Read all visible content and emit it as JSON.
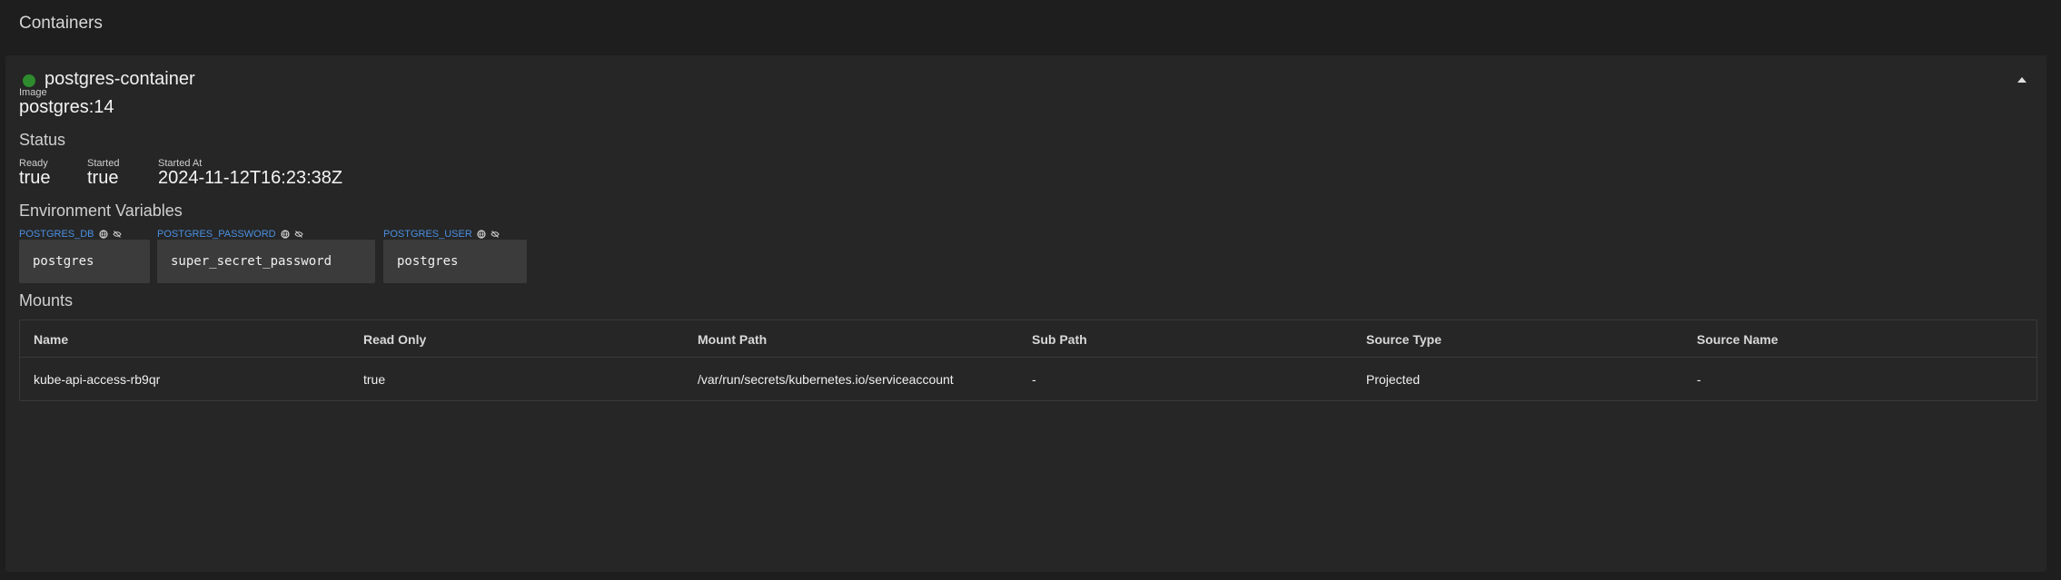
{
  "page": {
    "title": "Containers"
  },
  "container": {
    "name": "postgres-container",
    "status_color": "#2e8b2e",
    "collapse_icon": "chevron-up-icon",
    "image_label": "Image",
    "image_value": "postgres:14",
    "status_heading": "Status",
    "status_fields": [
      {
        "label": "Ready",
        "value": "true"
      },
      {
        "label": "Started",
        "value": "true"
      },
      {
        "label": "Started At",
        "value": "2024-11-12T16:23:38Z"
      }
    ],
    "env_heading": "Environment Variables",
    "env_vars": [
      {
        "name": "POSTGRES_DB",
        "value": "postgres"
      },
      {
        "name": "POSTGRES_PASSWORD",
        "value": "super_secret_password"
      },
      {
        "name": "POSTGRES_USER",
        "value": "postgres"
      }
    ],
    "env_icons": [
      "copy-icon",
      "eye-off-icon"
    ],
    "mounts_heading": "Mounts",
    "mounts": {
      "columns": [
        "Name",
        "Read Only",
        "Mount Path",
        "Sub Path",
        "Source Type",
        "Source Name"
      ],
      "rows": [
        [
          "kube-api-access-rb9qr",
          "true",
          "/var/run/secrets/kubernetes.io/serviceaccount",
          "-",
          "Projected",
          "-"
        ]
      ]
    }
  },
  "colors": {
    "background": "#1e1e1e",
    "card": "#262626",
    "env_label": "#4a8fe0",
    "env_box": "#3b3b3b"
  }
}
